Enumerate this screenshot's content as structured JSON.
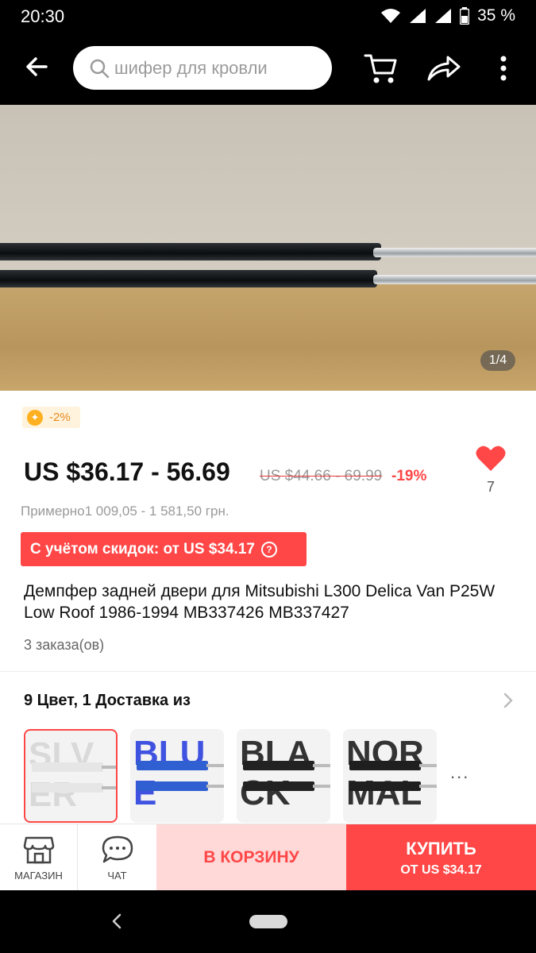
{
  "status_bar": {
    "time": "20:30",
    "battery": "35 %"
  },
  "search": {
    "placeholder": "шифер для кровли"
  },
  "gallery": {
    "counter": "1/4"
  },
  "coins_badge": {
    "coin_symbol": "✦",
    "text": "-2%"
  },
  "price": {
    "current": "US $36.17 - 56.69",
    "original": "US $44.66 - 69.99",
    "discount": "-19%",
    "approx": "Примерно1 009,05 - 1 581,50 грн."
  },
  "wishlist": {
    "count": "7"
  },
  "promo": {
    "text": "С учётом скидок: от US $34.17",
    "help": "?"
  },
  "product": {
    "title": "Демпфер задней двери для Mitsubishi L300 Delica Van P25W Low Roof 1986-1994 MB337426 MB337427",
    "orders": "3 заказа(ов)"
  },
  "variants": {
    "heading": "9 Цвет, 1 Доставка из",
    "more": "...",
    "items": [
      {
        "name": "SILVER",
        "label": "SLVER",
        "text_color": "#d9d9d9",
        "body_color": "#e6e6e6",
        "selected": true
      },
      {
        "name": "BLUE",
        "label": "BLUE",
        "text_color": "#3f52e0",
        "body_color": "#2f5fd0",
        "selected": false
      },
      {
        "name": "BLACK",
        "label": "BLACK",
        "text_color": "#333333",
        "body_color": "#222222",
        "selected": false
      },
      {
        "name": "NORMAL",
        "label": "NORMAL",
        "text_color": "#333333",
        "body_color": "#1f1f1f",
        "selected": false
      }
    ]
  },
  "bottom_bar": {
    "store_label": "МАГАЗИН",
    "chat_label": "ЧАТ",
    "add_to_cart": "В КОРЗИНУ",
    "buy_label": "КУПИТЬ",
    "buy_price": "ОТ US $34.17"
  },
  "colors": {
    "accent": "#ff4747",
    "add_to_cart_bg": "#ffd8d8",
    "coin": "#ffb020"
  }
}
